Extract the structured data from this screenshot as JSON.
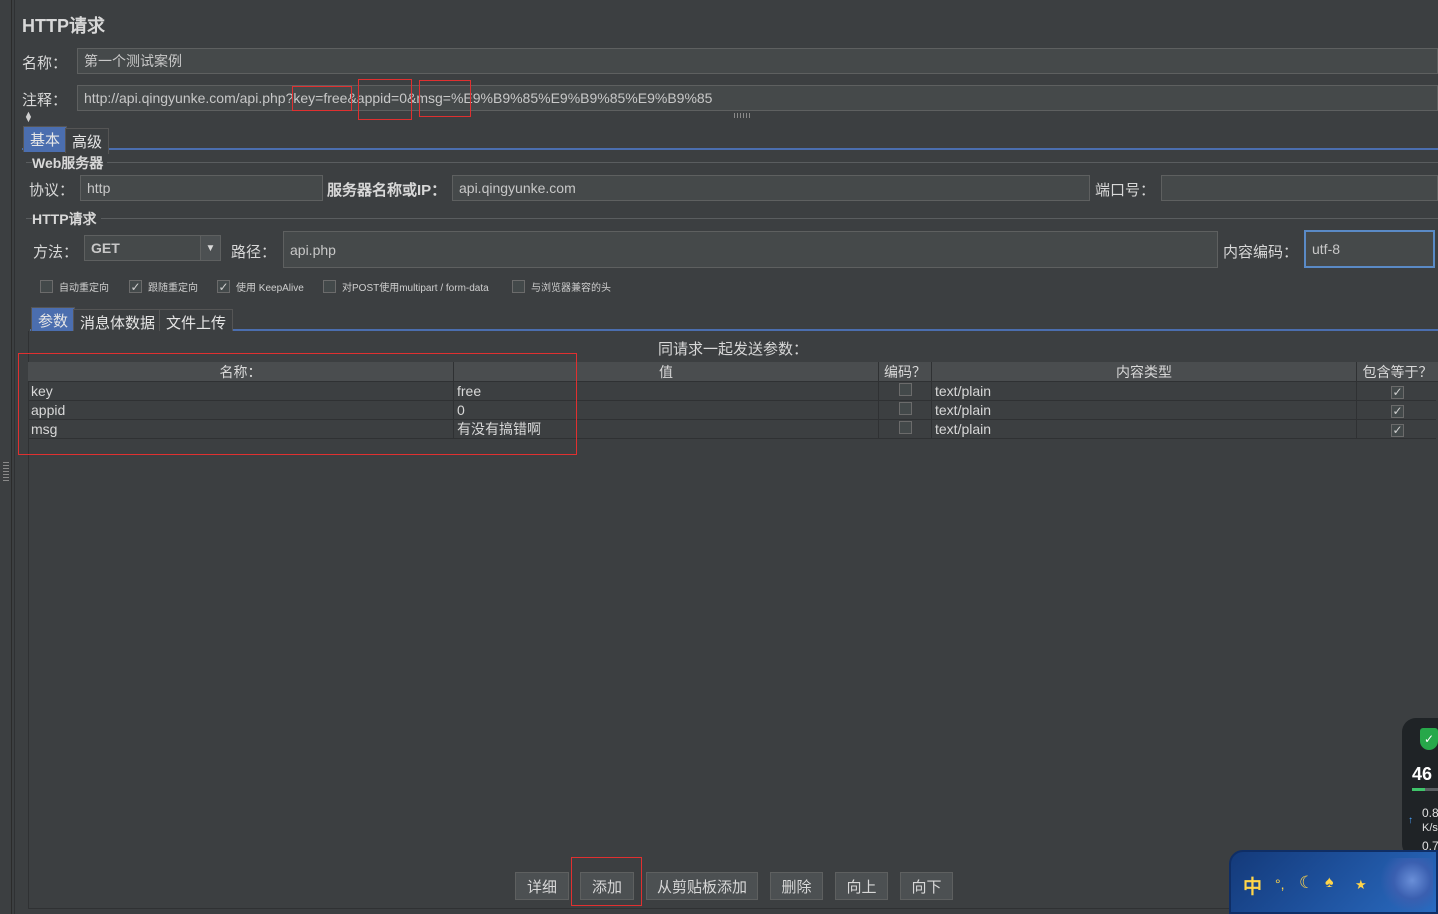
{
  "panel_title": "HTTP请求",
  "name_label": "名称：",
  "name_value": "第一个测试案例",
  "comment_label": "注释：",
  "comment_value": "http://api.qingyunke.com/api.php?key=free&appid=0&msg=%E9%B9%85%E9%B9%85%E9%B9%85",
  "tabs_top": [
    "基本",
    "高级"
  ],
  "web_server": {
    "section_title": "Web服务器",
    "protocol_label": "协议：",
    "protocol_value": "http",
    "server_label": "服务器名称或IP：",
    "server_value": "api.qingyunke.com",
    "port_label": "端口号：",
    "port_value": ""
  },
  "http_request": {
    "section_title": "HTTP请求",
    "method_label": "方法：",
    "method_value": "GET",
    "path_label": "路径：",
    "path_value": "api.php",
    "encoding_label": "内容编码：",
    "encoding_value": "utf-8"
  },
  "options": [
    {
      "label": "自动重定向",
      "checked": false
    },
    {
      "label": "跟随重定向",
      "checked": true
    },
    {
      "label": "使用 KeepAlive",
      "checked": true
    },
    {
      "label": "对POST使用multipart / form-data",
      "checked": false
    },
    {
      "label": "与浏览器兼容的头",
      "checked": false
    }
  ],
  "tabs_params": [
    "参数",
    "消息体数据",
    "文件上传"
  ],
  "params_title": "同请求一起发送参数：",
  "table": {
    "headers": [
      "名称：",
      "值",
      "编码？",
      "内容类型",
      "包含等于？"
    ],
    "rows": [
      {
        "name": "key",
        "value": "free",
        "encode": false,
        "content_type": "text/plain",
        "include_equals": true
      },
      {
        "name": "appid",
        "value": "0",
        "encode": false,
        "content_type": "text/plain",
        "include_equals": true
      },
      {
        "name": "msg",
        "value": "有没有搞错啊",
        "encode": false,
        "content_type": "text/plain",
        "include_equals": true
      }
    ]
  },
  "buttons": [
    "详细",
    "添加",
    "从剪贴板添加",
    "删除",
    "向上",
    "向下"
  ],
  "tray": {
    "ime_label": "中",
    "widget_number": "46",
    "speed_top": "0.8",
    "speed_unit": "K/s",
    "speed_bottom": "0.7"
  },
  "colors": {
    "accent_tab": "#4b6eaf",
    "highlight_box": "#e03030",
    "background": "#3c3f41"
  }
}
